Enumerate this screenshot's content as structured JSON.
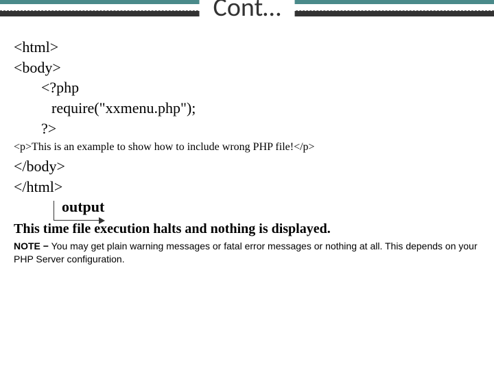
{
  "title": "Cont…",
  "code": {
    "l1": "<html>",
    "l2": "<body>",
    "l3": "<?php",
    "l4": "require(\"xxmenu.php\");",
    "l5": "?>",
    "l6": "<p>This is an example to show how to include wrong PHP file!</p>",
    "l7": "</body>",
    "l8": "</html>"
  },
  "output_label": "output",
  "result": "This time file execution halts and nothing is displayed.",
  "note_label": "NOTE −",
  "note_text": " You may get plain warning messages or fatal error messages or nothing at all. This depends on your PHP Server configuration."
}
